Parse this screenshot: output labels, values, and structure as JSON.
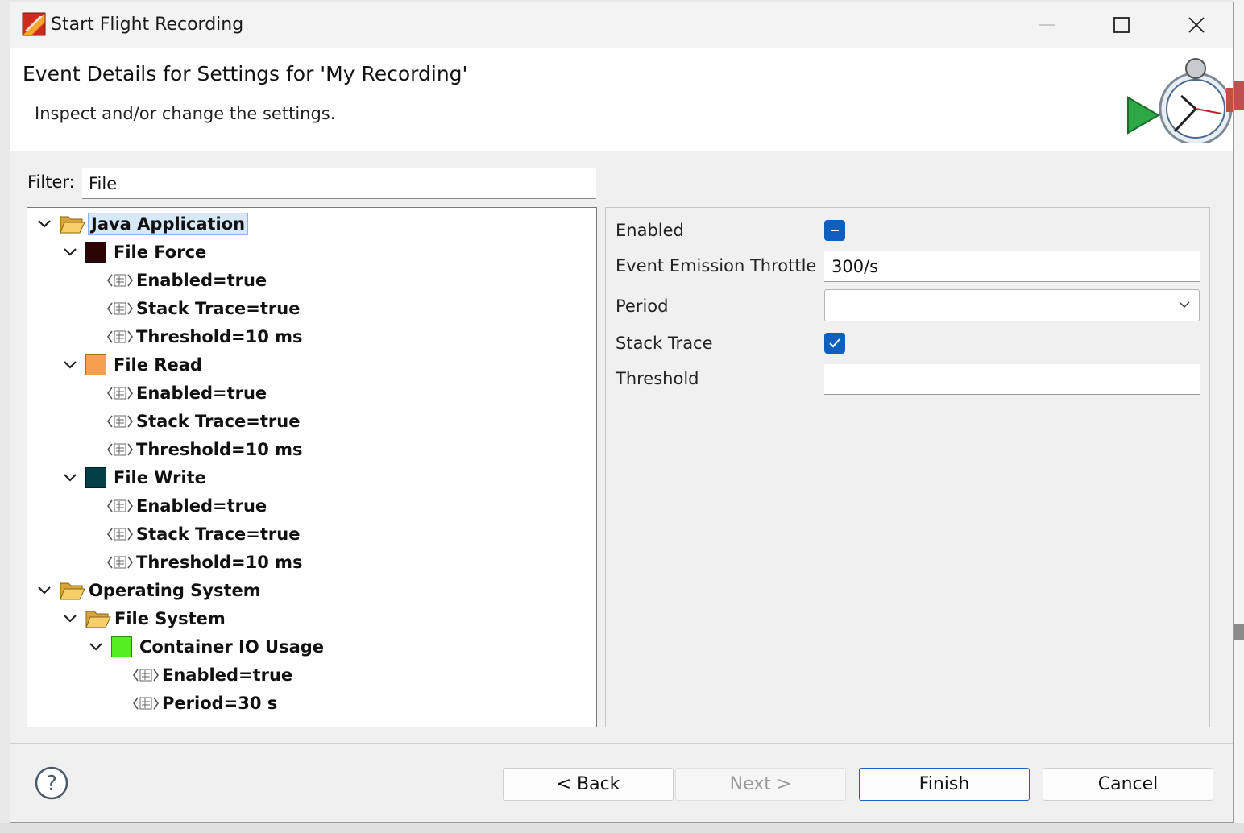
{
  "window": {
    "title": "Start Flight Recording",
    "controls": {
      "minimize": "—",
      "maximize": "☐",
      "close": "✕"
    }
  },
  "header": {
    "title": "Event Details for Settings for 'My Recording'",
    "subtitle": "Inspect and/or change the settings."
  },
  "filter": {
    "label": "Filter:",
    "value": "File"
  },
  "tree": {
    "java_application": "Java Application",
    "file_force": "File Force",
    "file_force_enabled": "Enabled=true",
    "file_force_stack": "Stack Trace=true",
    "file_force_threshold": "Threshold=10 ms",
    "file_read": "File Read",
    "file_read_enabled": "Enabled=true",
    "file_read_stack": "Stack Trace=true",
    "file_read_threshold": "Threshold=10 ms",
    "file_write": "File Write",
    "file_write_enabled": "Enabled=true",
    "file_write_stack": "Stack Trace=true",
    "file_write_threshold": "Threshold=10 ms",
    "operating_system": "Operating System",
    "file_system": "File System",
    "container_io": "Container IO Usage",
    "container_io_enabled": "Enabled=true",
    "container_io_period": "Period=30 s",
    "colors": {
      "file_force": "#2d0404",
      "file_read": "#f6a04d",
      "file_write": "#043e47",
      "container_io": "#55ee1e"
    }
  },
  "properties": {
    "enabled_label": "Enabled",
    "enabled_state": "indeterminate",
    "throttle_label": "Event Emission Throttle",
    "throttle_value": "300/s",
    "period_label": "Period",
    "period_value": "",
    "stack_trace_label": "Stack Trace",
    "stack_trace_state": "checked",
    "threshold_label": "Threshold",
    "threshold_value": ""
  },
  "buttons": {
    "back": "< Back",
    "next": "Next >",
    "finish": "Finish",
    "cancel": "Cancel"
  },
  "accent_color": "#0f5fbf"
}
